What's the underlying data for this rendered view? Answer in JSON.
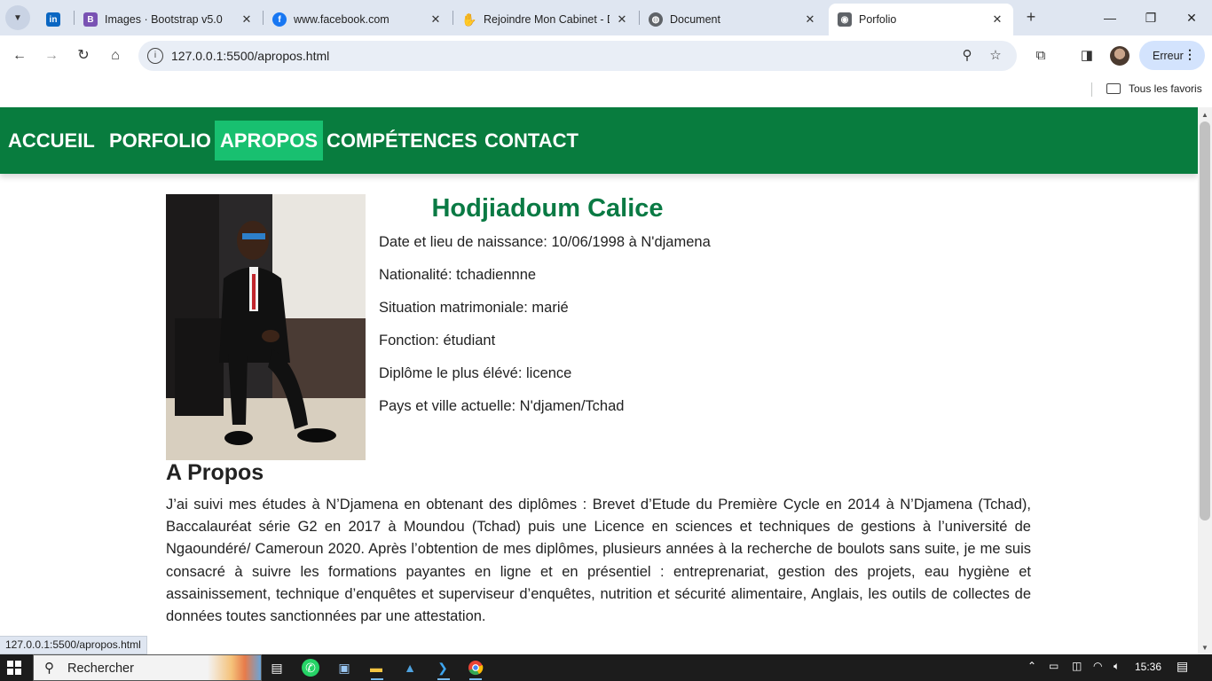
{
  "browser": {
    "tabs": [
      {
        "title": "",
        "icon": "linkedin-icon",
        "color": "#0a66c2"
      },
      {
        "title": "Images · Bootstrap v5.0",
        "icon": "bootstrap-icon",
        "color": "#7952b3"
      },
      {
        "title": "www.facebook.com",
        "icon": "facebook-icon",
        "color": "#1877f2"
      },
      {
        "title": "Rejoindre Mon Cabinet - D",
        "icon": "cabinet-icon",
        "color": "#2b3c8c"
      },
      {
        "title": "Document",
        "icon": "globe-icon",
        "color": "#5f6368"
      },
      {
        "title": "Porfolio",
        "icon": "broadcast-icon",
        "color": "#5f6368"
      }
    ],
    "url": "127.0.0.1:5500/apropos.html",
    "profile_button": "Erreur",
    "bookmarks_folder": "Tous les favoris",
    "status_url": "127.0.0.1:5500/apropos.html"
  },
  "site": {
    "nav": [
      "ACCUEIL",
      "PORFOLIO",
      "APROPOS",
      "COMPÉTENCES",
      "CONTACT"
    ],
    "active_nav": "APROPOS",
    "brand_color": "#087c3e",
    "active_color": "#18c070",
    "name": "Hodjiadoum Calice",
    "info": [
      "Date et lieu de naissance: 10/06/1998 à N'djamena",
      "Nationalité: tchadiennne",
      "Situation matrimoniale: marié",
      "Fonction: étudiant",
      "Diplôme le plus élévé: licence",
      "Pays et ville actuelle: N'djamen/Tchad"
    ],
    "about_title": "A Propos",
    "about_text": "J’ai suivi mes études à N’Djamena en obtenant des diplômes : Brevet d’Etude du Première Cycle en 2014 à N’Djamena (Tchad), Baccalauréat série G2 en 2017 à Moundou (Tchad) puis une Licence en sciences et techniques de gestions à l’université de Ngaoundéré/ Cameroun 2020. Après l’obtention de mes diplômes, plusieurs années à la recherche de boulots sans suite, je me suis consacré à suivre les formations payantes en ligne et en présentiel : entreprenariat, gestion des projets, eau hygiène et assainissement, technique d’enquêtes et superviseur d’enquêtes, nutrition et sécurité alimentaire, Anglais, les outils de collectes de données toutes sanctionnées par une attestation."
  },
  "taskbar": {
    "search_placeholder": "Rechercher",
    "time": "15:36"
  }
}
